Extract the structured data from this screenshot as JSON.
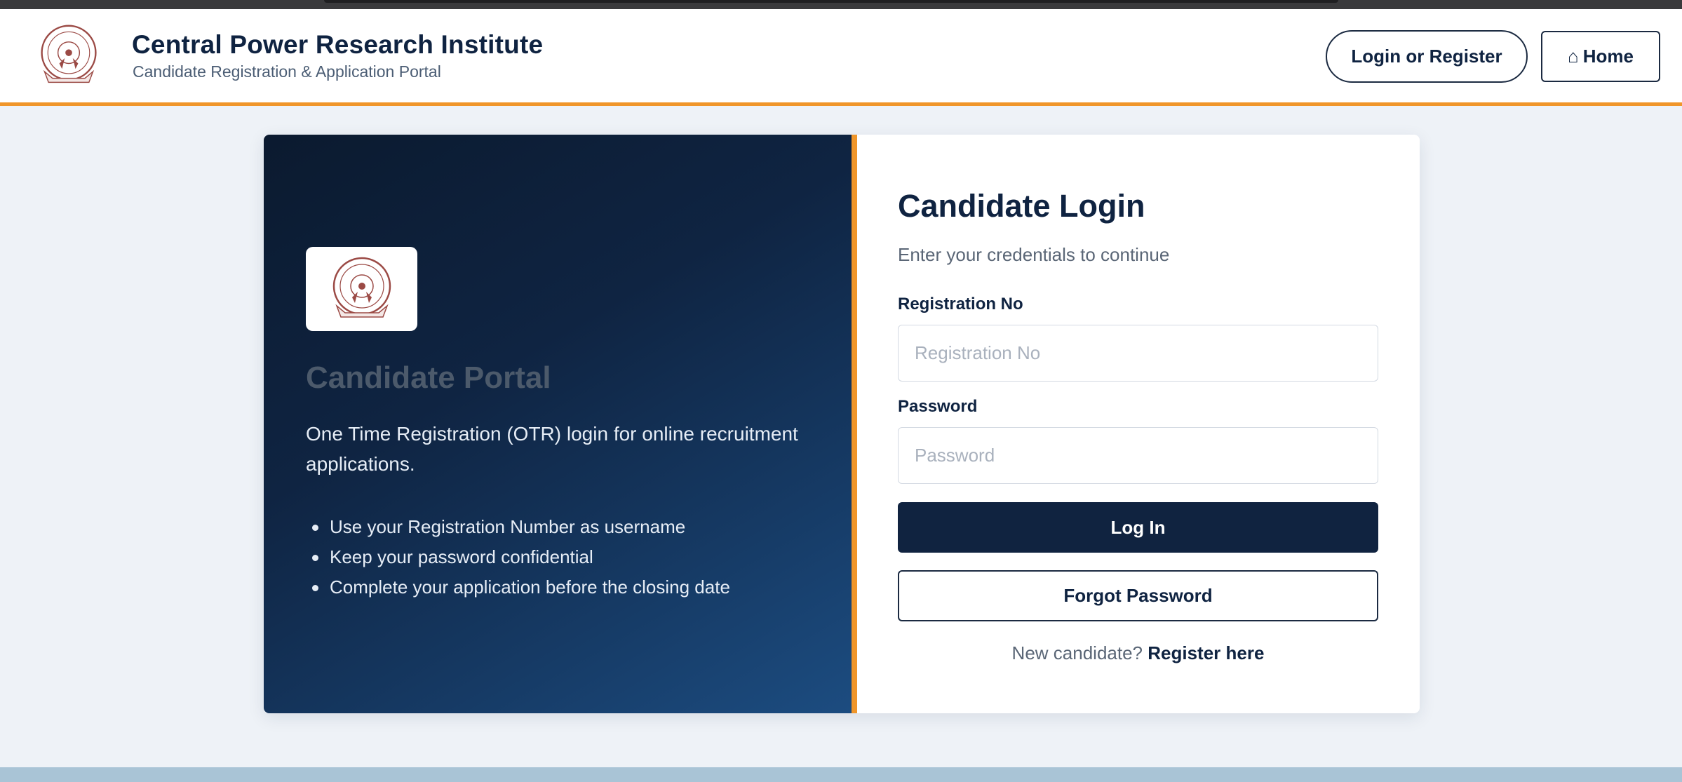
{
  "header": {
    "title": "Central Power Research Institute",
    "subtitle": "Candidate Registration & Application Portal",
    "login_register_label": "Login or Register",
    "home_icon": "home-icon",
    "home_label": "Home"
  },
  "left_panel": {
    "title": "Candidate Portal",
    "description": "One Time Registration (OTR) login for online recruitment applications.",
    "points": [
      "Use your Registration Number as username",
      "Keep your password confidential",
      "Complete your application before the closing date"
    ]
  },
  "form": {
    "title": "Candidate Login",
    "subtitle": "Enter your credentials to continue",
    "registration_label": "Registration No",
    "registration_placeholder": "Registration No",
    "registration_value": "",
    "password_label": "Password",
    "password_placeholder": "Password",
    "password_value": "",
    "login_button": "Log In",
    "forgot_button": "Forgot Password",
    "new_candidate_text": "New candidate?",
    "register_link": "Register here"
  },
  "colors": {
    "accent": "#f0962a",
    "primary": "#102340",
    "background": "#eef2f7"
  }
}
